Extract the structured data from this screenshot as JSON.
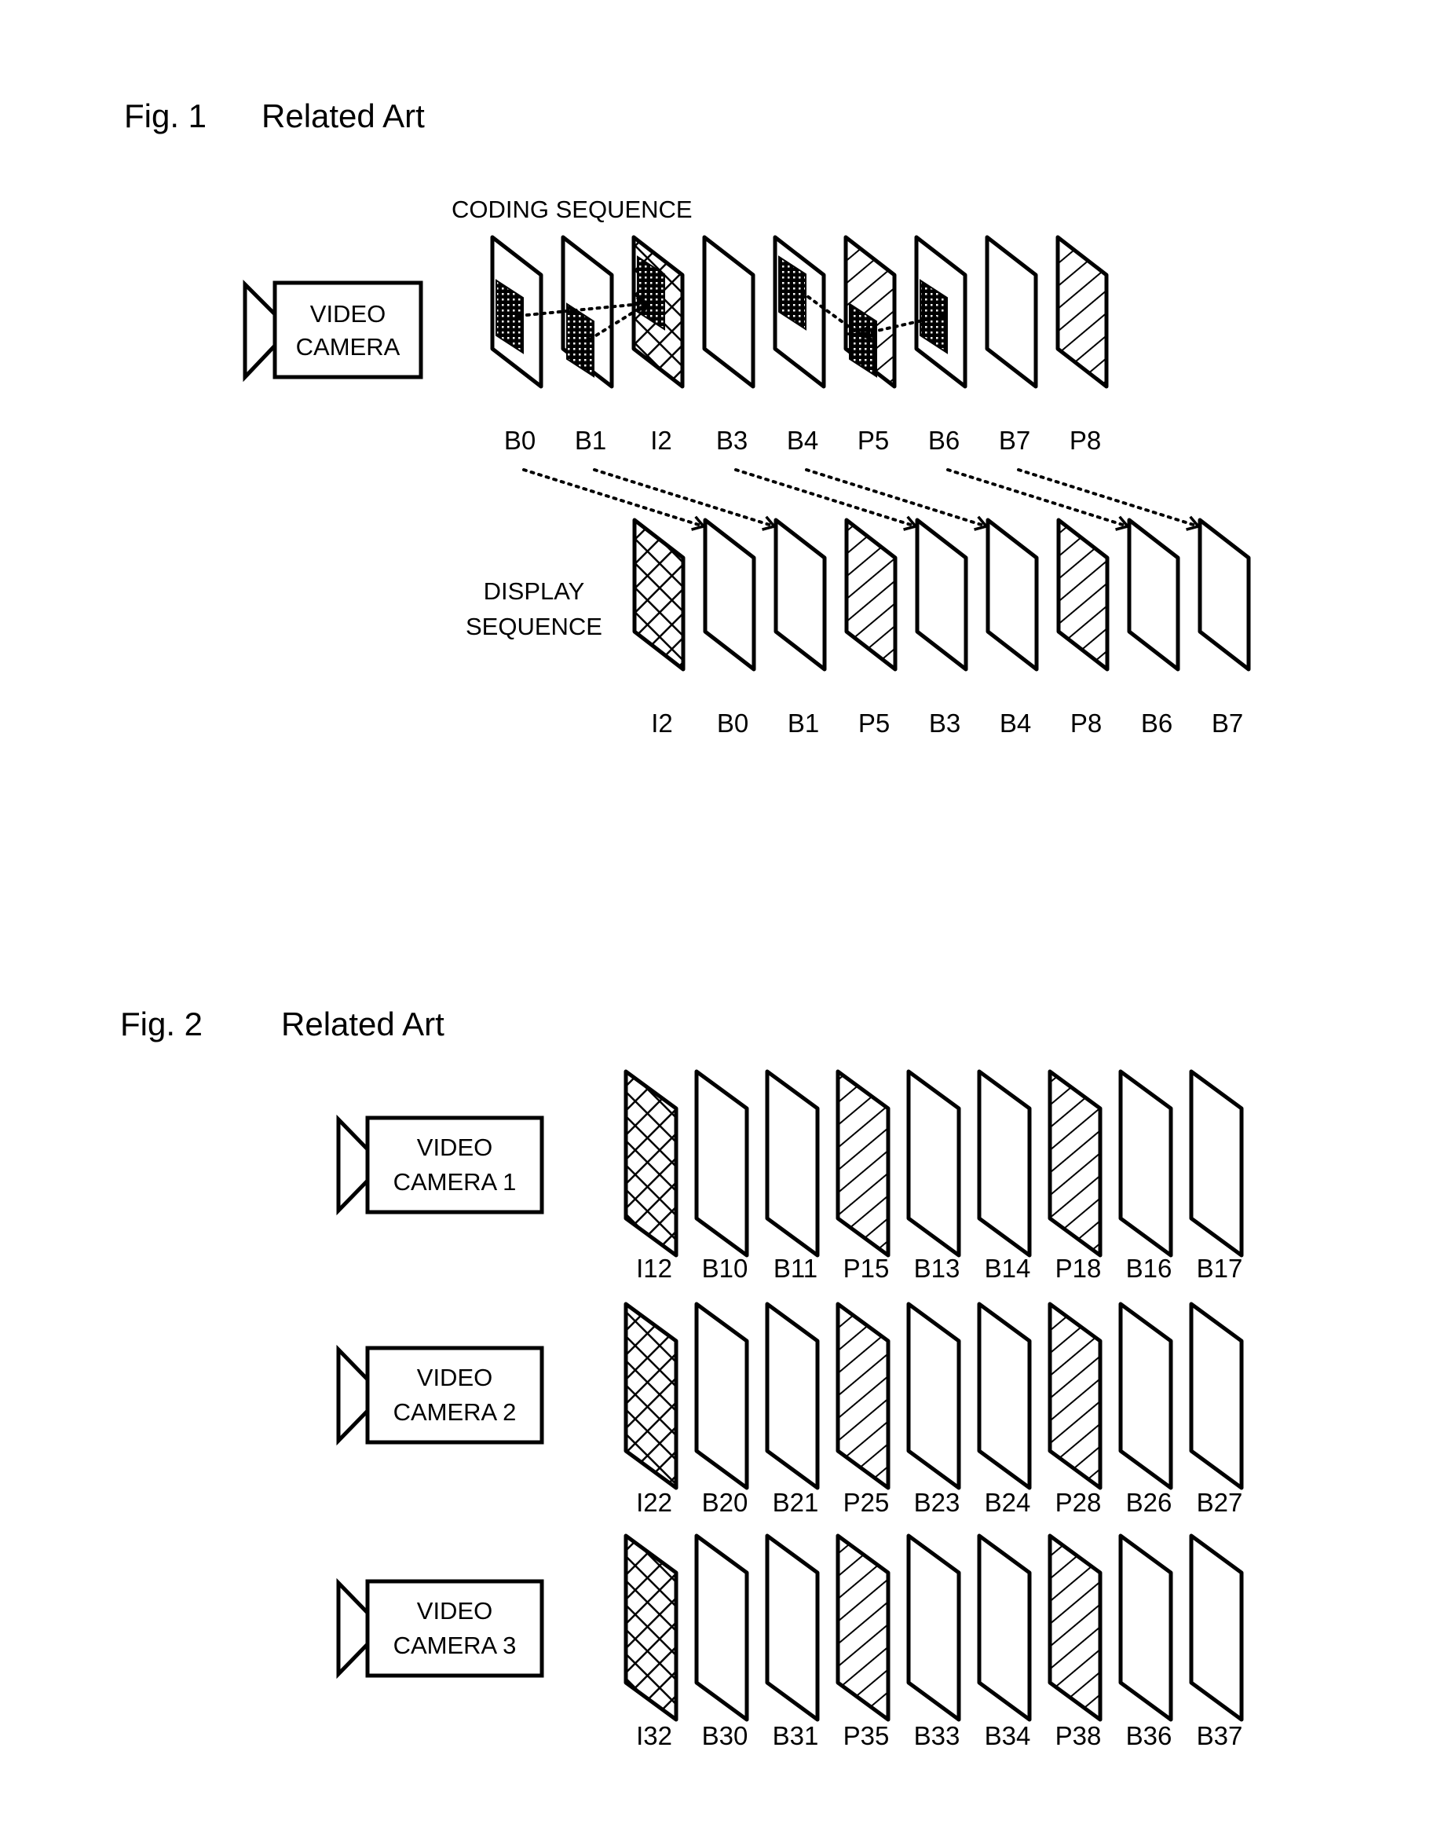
{
  "colors": {
    "ink": "#000000",
    "paper": "#ffffff"
  },
  "frame_types": {
    "I": "cross-hatch",
    "P": "diagonal-hatch",
    "B": "plain"
  },
  "figure1": {
    "number": "Fig. 1",
    "caption": "Related Art",
    "camera": {
      "line1": "VIDEO",
      "line2": "CAMERA",
      "icon": "video-camera-icon"
    },
    "coding_sequence": {
      "label": "CODING SEQUENCE",
      "frames": [
        {
          "label": "B0",
          "type": "B",
          "block": "middle"
        },
        {
          "label": "B1",
          "type": "B",
          "block": "lower"
        },
        {
          "label": "I2",
          "type": "I",
          "block": "upper"
        },
        {
          "label": "B3",
          "type": "B",
          "block": null
        },
        {
          "label": "B4",
          "type": "B",
          "block": "upper"
        },
        {
          "label": "P5",
          "type": "P",
          "block": "lower"
        },
        {
          "label": "B6",
          "type": "B",
          "block": "middle"
        },
        {
          "label": "B7",
          "type": "B",
          "block": null
        },
        {
          "label": "P8",
          "type": "P",
          "block": null
        }
      ],
      "references": [
        {
          "from": "B0",
          "to": "I2"
        },
        {
          "from": "B1",
          "to": "I2"
        },
        {
          "from": "B4",
          "to": "P5"
        },
        {
          "from": "B6",
          "to": "P5"
        }
      ]
    },
    "display_sequence": {
      "label_line1": "DISPLAY",
      "label_line2": "SEQUENCE",
      "frames": [
        {
          "label": "I2",
          "type": "I"
        },
        {
          "label": "B0",
          "type": "B"
        },
        {
          "label": "B1",
          "type": "B"
        },
        {
          "label": "P5",
          "type": "P"
        },
        {
          "label": "B3",
          "type": "B"
        },
        {
          "label": "B4",
          "type": "B"
        },
        {
          "label": "P8",
          "type": "P"
        },
        {
          "label": "B6",
          "type": "B"
        },
        {
          "label": "B7",
          "type": "B"
        }
      ]
    },
    "reorder_arrows": [
      {
        "from": "B0",
        "to": "B0"
      },
      {
        "from": "B1",
        "to": "B1"
      },
      {
        "from": "B3",
        "to": "B3"
      },
      {
        "from": "B4",
        "to": "B4"
      },
      {
        "from": "B6",
        "to": "B6"
      },
      {
        "from": "B7",
        "to": "B7"
      }
    ]
  },
  "figure2": {
    "number": "Fig. 2",
    "caption": "Related Art",
    "rows": [
      {
        "camera": {
          "line1": "VIDEO",
          "line2": "CAMERA 1"
        },
        "frames": [
          {
            "label": "I12",
            "type": "I"
          },
          {
            "label": "B10",
            "type": "B"
          },
          {
            "label": "B11",
            "type": "B"
          },
          {
            "label": "P15",
            "type": "P"
          },
          {
            "label": "B13",
            "type": "B"
          },
          {
            "label": "B14",
            "type": "B"
          },
          {
            "label": "P18",
            "type": "P"
          },
          {
            "label": "B16",
            "type": "B"
          },
          {
            "label": "B17",
            "type": "B"
          }
        ]
      },
      {
        "camera": {
          "line1": "VIDEO",
          "line2": "CAMERA 2"
        },
        "frames": [
          {
            "label": "I22",
            "type": "I"
          },
          {
            "label": "B20",
            "type": "B"
          },
          {
            "label": "B21",
            "type": "B"
          },
          {
            "label": "P25",
            "type": "P"
          },
          {
            "label": "B23",
            "type": "B"
          },
          {
            "label": "B24",
            "type": "B"
          },
          {
            "label": "P28",
            "type": "P"
          },
          {
            "label": "B26",
            "type": "B"
          },
          {
            "label": "B27",
            "type": "B"
          }
        ]
      },
      {
        "camera": {
          "line1": "VIDEO",
          "line2": "CAMERA 3"
        },
        "frames": [
          {
            "label": "I32",
            "type": "I"
          },
          {
            "label": "B30",
            "type": "B"
          },
          {
            "label": "B31",
            "type": "B"
          },
          {
            "label": "P35",
            "type": "P"
          },
          {
            "label": "B33",
            "type": "B"
          },
          {
            "label": "B34",
            "type": "B"
          },
          {
            "label": "P38",
            "type": "P"
          },
          {
            "label": "B36",
            "type": "B"
          },
          {
            "label": "B37",
            "type": "B"
          }
        ]
      }
    ]
  }
}
